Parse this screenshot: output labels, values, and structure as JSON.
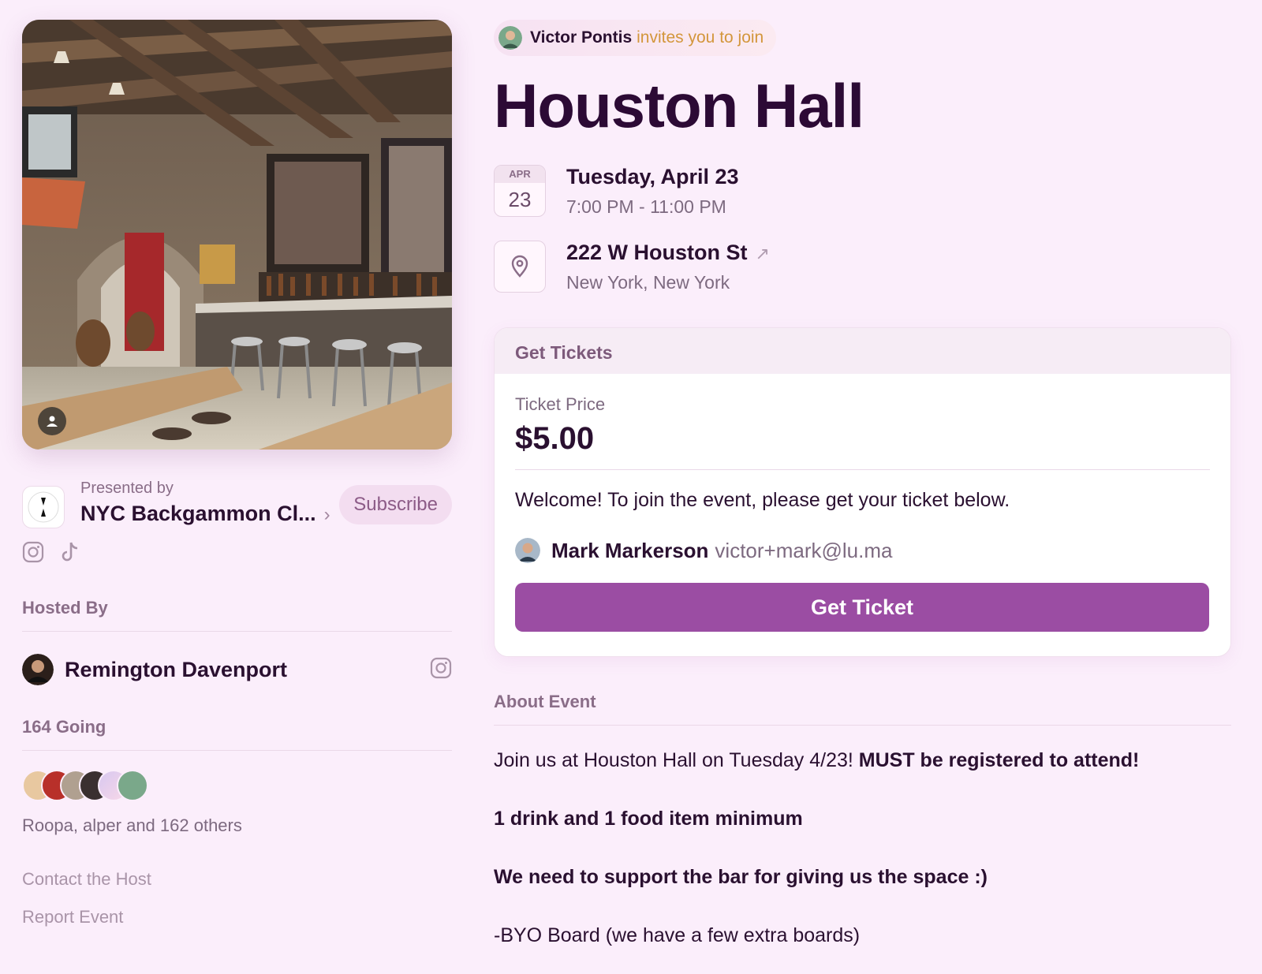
{
  "invite": {
    "inviter": "Victor Pontis",
    "text": "invites you to join"
  },
  "event": {
    "title": "Houston Hall",
    "date": {
      "month": "APR",
      "day": "23",
      "label": "Tuesday, April 23",
      "time": "7:00 PM - 11:00 PM"
    },
    "location": {
      "address": "222 W Houston St",
      "city": "New York, New York"
    }
  },
  "presenter": {
    "label": "Presented by",
    "name": "NYC Backgammon Cl...",
    "subscribe": "Subscribe"
  },
  "hosted": {
    "label": "Hosted By",
    "host": "Remington Davenport"
  },
  "going": {
    "label": "164 Going",
    "names": "Roopa, alper and 162 others"
  },
  "links": {
    "contact": "Contact the Host",
    "report": "Report Event"
  },
  "tickets": {
    "header": "Get Tickets",
    "price_label": "Ticket Price",
    "price": "$5.00",
    "welcome": "Welcome! To join the event, please get your ticket below.",
    "user_name": "Mark Markerson",
    "user_email": "victor+mark@lu.ma",
    "button": "Get Ticket"
  },
  "about": {
    "label": "About Event",
    "p1_plain": "Join us at Houston Hall on Tuesday 4/23! ",
    "p1_bold": "MUST be registered to attend!",
    "p2": "1 drink and 1 food item minimum",
    "p3": "We need to support the bar for giving us the space :)",
    "p4": "-BYO Board (we have a few extra boards)"
  },
  "colors": {
    "background": "#fbeefb",
    "accent": "#9b4da3",
    "title": "#2c0a35",
    "invite_text": "#d3963b"
  }
}
